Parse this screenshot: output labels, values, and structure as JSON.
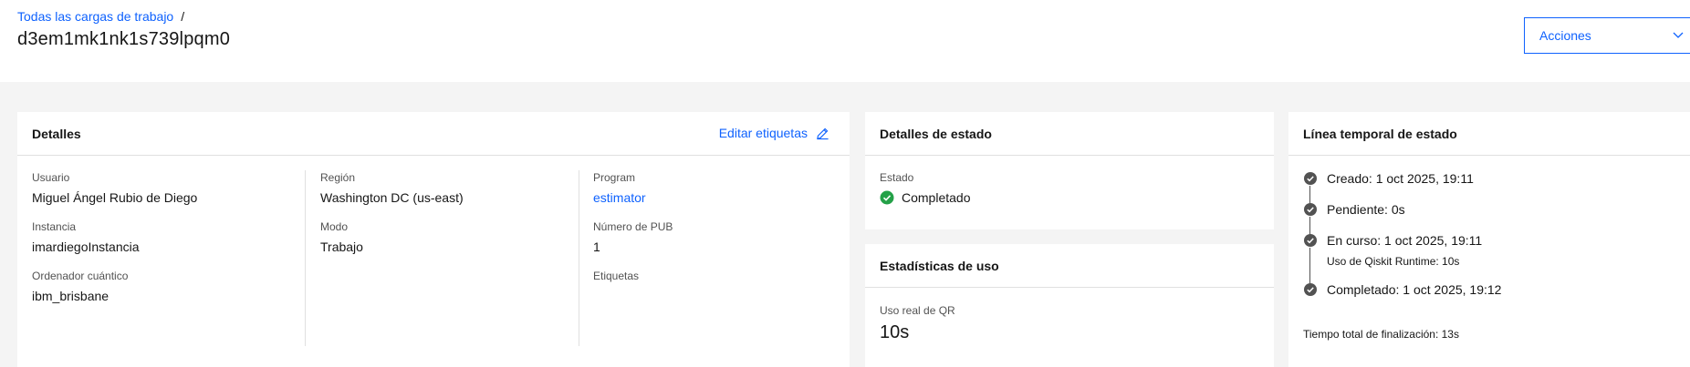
{
  "breadcrumb": {
    "parent": "Todas las cargas de trabajo",
    "separator": "/"
  },
  "page": {
    "title": "d3em1mk1nk1s739lpqm0"
  },
  "actions": {
    "label": "Acciones"
  },
  "details": {
    "title": "Detalles",
    "edit_tags": "Editar etiquetas",
    "user_label": "Usuario",
    "user_value": "Miguel Ángel Rubio de Diego",
    "instance_label": "Instancia",
    "instance_value": "imardiegoInstancia",
    "qc_label": "Ordenador cuántico",
    "qc_value": "ibm_brisbane",
    "region_label": "Región",
    "region_value": "Washington DC (us-east)",
    "mode_label": "Modo",
    "mode_value": "Trabajo",
    "program_label": "Program",
    "program_value": "estimator",
    "pub_label": "Número de PUB",
    "pub_value": "1",
    "tags_label": "Etiquetas"
  },
  "status_details": {
    "title": "Detalles de estado",
    "state_label": "Estado",
    "state_value": "Completado",
    "state_color": "#24a148"
  },
  "usage_stats": {
    "title": "Estadísticas de uso",
    "qr_label": "Uso real de QR",
    "qr_value": "10s"
  },
  "timeline": {
    "title": "Línea temporal de estado",
    "items": [
      {
        "label": "Creado: 1 oct 2025, 19:11"
      },
      {
        "label": "Pendiente: 0s"
      },
      {
        "label": "En curso: 1 oct 2025, 19:11",
        "sub": "Uso de Qiskit Runtime:  10s"
      },
      {
        "label": "Completado: 1 oct 2025, 19:12"
      }
    ],
    "total": "Tiempo total de finalización: 13s"
  },
  "colors": {
    "link": "#0f62fe",
    "background": "#f4f4f4",
    "success": "#24a148"
  }
}
